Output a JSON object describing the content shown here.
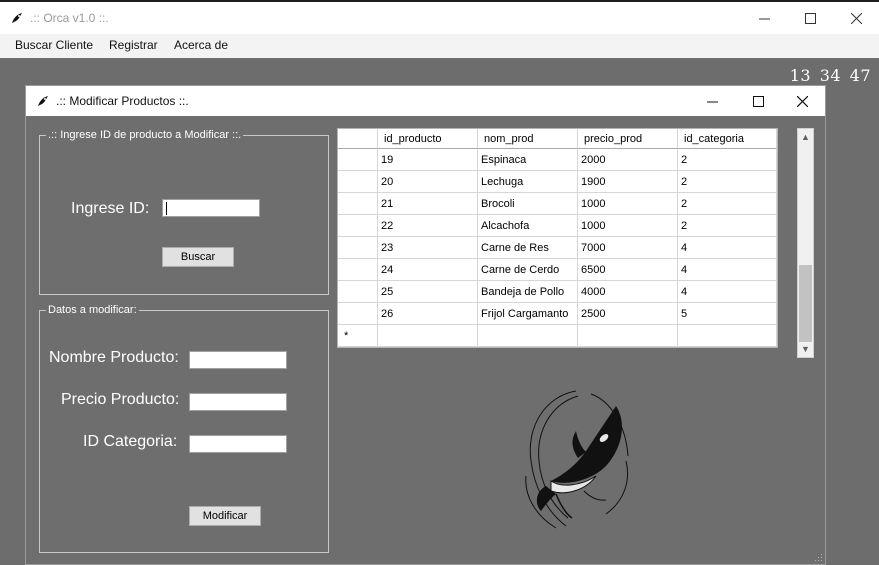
{
  "outer_window": {
    "title": ".:: Orca v1.0 ::.",
    "menu": [
      "Buscar Cliente",
      "Registrar",
      "Acerca de"
    ]
  },
  "clock": "13 34 47",
  "dialog": {
    "title": ".:: Modificar Productos ::.",
    "search_group": {
      "legend": ".:: Ingrese ID de producto a Modificar ::.",
      "id_label": "Ingrese ID:",
      "id_value": "",
      "search_button": "Buscar"
    },
    "modify_group": {
      "legend": "Datos a modificar:",
      "name_label": "Nombre Producto:",
      "name_value": "",
      "price_label": "Precio Producto:",
      "price_value": "",
      "category_label": "ID Categoria:",
      "category_value": "",
      "modify_button": "Modificar"
    },
    "grid": {
      "columns": [
        "id_producto",
        "nom_prod",
        "precio_prod",
        "id_categoria"
      ],
      "rows": [
        [
          "19",
          "Espinaca",
          "2000",
          "2"
        ],
        [
          "20",
          "Lechuga",
          "1900",
          "2"
        ],
        [
          "21",
          "Brocoli",
          "1000",
          "2"
        ],
        [
          "22",
          "Alcachofa",
          "1000",
          "2"
        ],
        [
          "23",
          "Carne de Res",
          "7000",
          "4"
        ],
        [
          "24",
          "Carne de Cerdo",
          "6500",
          "4"
        ],
        [
          "25",
          "Bandeja de Pollo",
          "4000",
          "4"
        ],
        [
          "26",
          "Frijol Cargamanto",
          "2500",
          "5"
        ]
      ],
      "new_row_marker": "*"
    }
  },
  "icons": {
    "app": "orca-icon",
    "minimize": "minimize-icon",
    "maximize": "maximize-icon",
    "close": "close-icon",
    "logo": "orca-logo"
  }
}
